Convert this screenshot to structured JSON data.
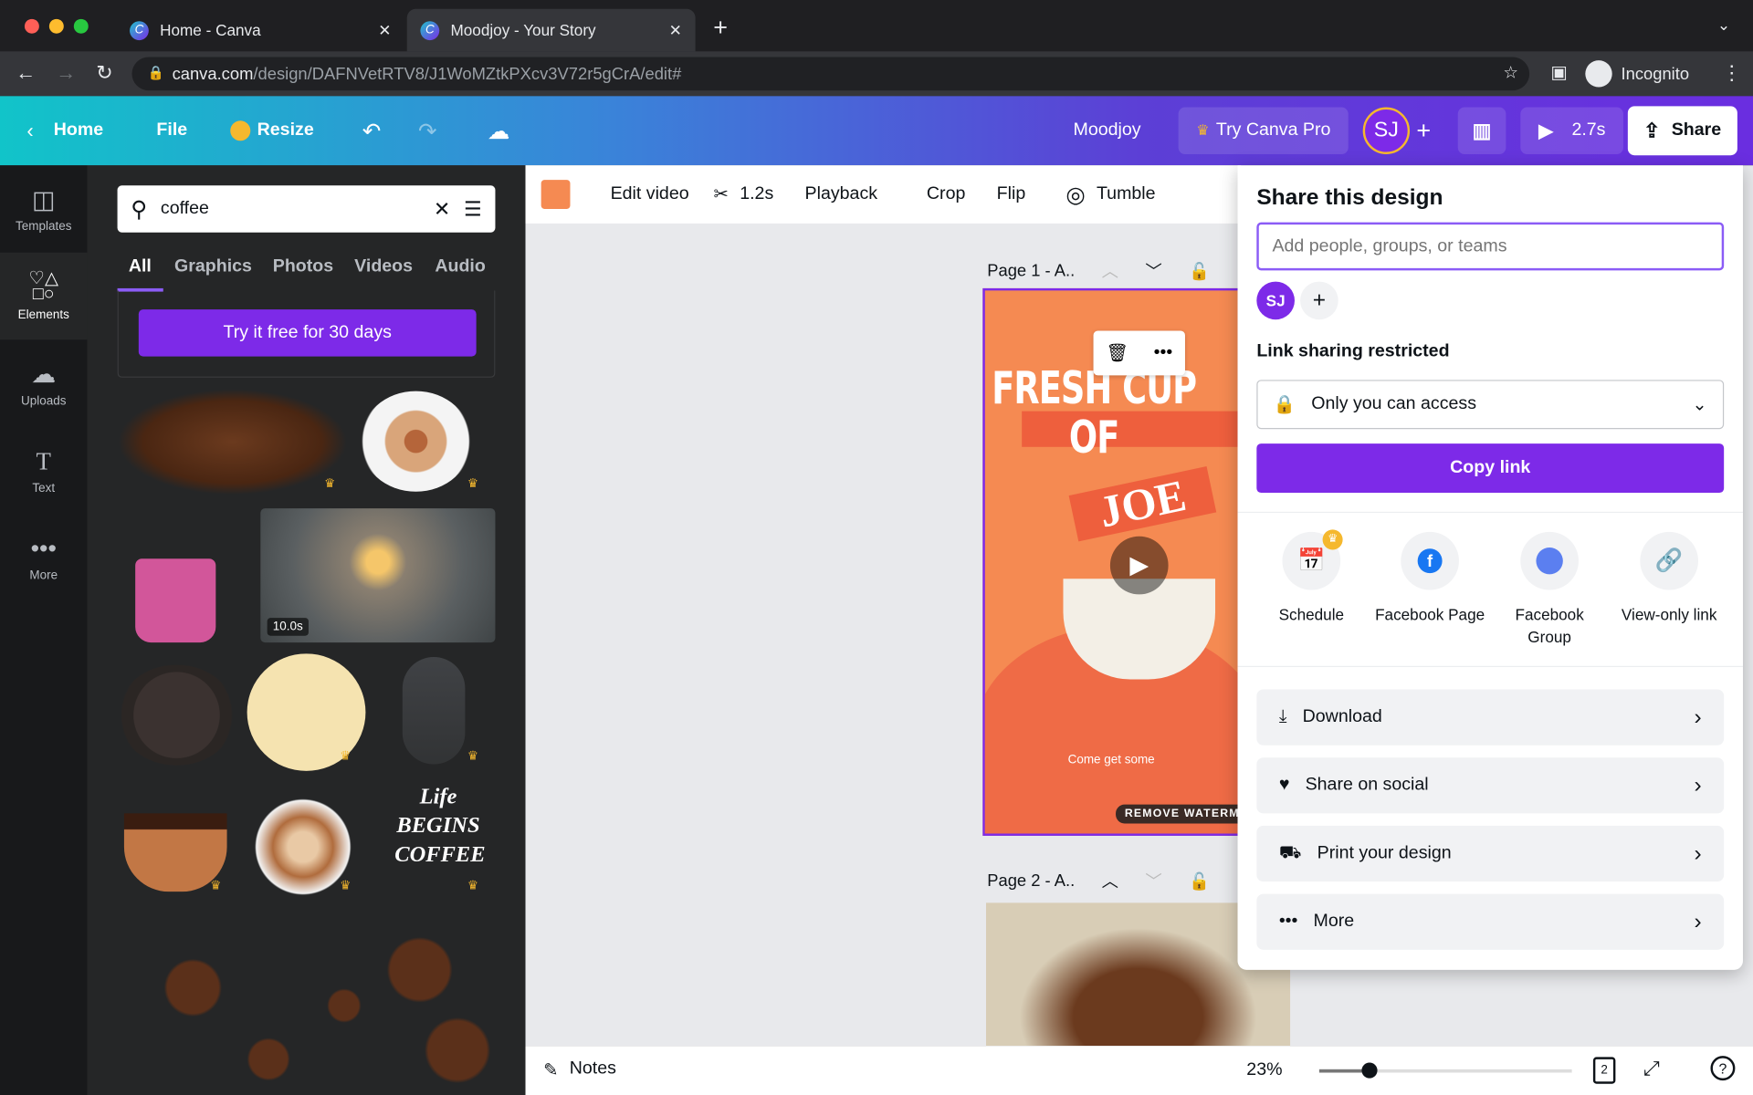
{
  "browser": {
    "tabs": [
      {
        "title": "Home - Canva",
        "active": false
      },
      {
        "title": "Moodjoy - Your Story",
        "active": true
      }
    ],
    "url_host": "canva.com",
    "url_path": "/design/DAFNVetRTV8/J1WoMZtkPXcv3V72r5gCrA/edit#",
    "profile": "Incognito"
  },
  "topbar": {
    "home": "Home",
    "file": "File",
    "resize": "Resize",
    "design_name": "Moodjoy",
    "try_pro": "Try Canva Pro",
    "avatar": "SJ",
    "duration": "2.7s",
    "share": "Share"
  },
  "sidebar": {
    "items": [
      {
        "label": "Templates",
        "icon": "templates-icon"
      },
      {
        "label": "Elements",
        "icon": "elements-icon",
        "active": true
      },
      {
        "label": "Uploads",
        "icon": "upload-icon"
      },
      {
        "label": "Text",
        "icon": "text-icon"
      },
      {
        "label": "More",
        "icon": "more-icon"
      }
    ]
  },
  "panel": {
    "search_value": "coffee",
    "filters": [
      "All",
      "Graphics",
      "Photos",
      "Videos",
      "Audio"
    ],
    "active_filter": "All",
    "promo_button": "Try it free for 30 days",
    "video_duration": "10.0s"
  },
  "toolbar": {
    "color": "#f58a52",
    "edit_video": "Edit video",
    "trim": "1.2s",
    "playback": "Playback",
    "crop": "Crop",
    "flip": "Flip",
    "tumble": "Tumble"
  },
  "canvas": {
    "page1": "Page 1 - A..",
    "page2": "Page 2 - A..",
    "design_title_1": "FRESH CUP",
    "design_title_2": "OF",
    "design_title_3": "JOE",
    "design_subtitle": "Come get some",
    "watermark": "REMOVE WATERM"
  },
  "share_panel": {
    "title": "Share this design",
    "people_placeholder": "Add people, groups, or teams",
    "avatar": "SJ",
    "link_label": "Link sharing restricted",
    "access": "Only you can access",
    "copy_link": "Copy link",
    "options": [
      {
        "label": "Schedule",
        "icon": "calendar-icon",
        "pro": true
      },
      {
        "label": "Facebook Page",
        "icon": "facebook-icon"
      },
      {
        "label": "Facebook Group",
        "icon": "facebook-group-icon"
      },
      {
        "label": "View-only link",
        "icon": "link-icon"
      }
    ],
    "rows": [
      {
        "label": "Download",
        "icon": "download-icon"
      },
      {
        "label": "Share on social",
        "icon": "heart-icon"
      },
      {
        "label": "Print your design",
        "icon": "truck-icon"
      },
      {
        "label": "More",
        "icon": "more-icon"
      }
    ]
  },
  "bottombar": {
    "notes": "Notes",
    "zoom": "23%",
    "zoom_level": 23,
    "pages": "2"
  },
  "colors": {
    "accent": "#7d2ae8",
    "canvas_orange": "#f58a52"
  }
}
